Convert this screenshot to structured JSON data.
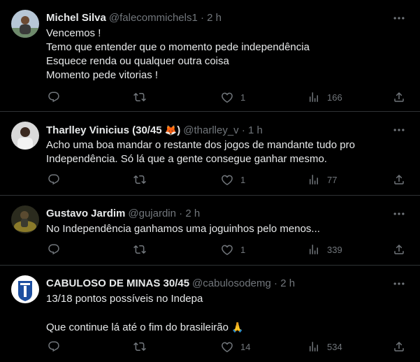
{
  "tweets": [
    {
      "name": "Michel Silva",
      "handle": "@falecommichels1",
      "dot": "·",
      "time": "2 h",
      "lines": [
        "Vencemos !",
        "Temo que entender que o momento pede independência",
        "Esquece renda ou qualquer outra coisa",
        "Momento pede vitorias !"
      ],
      "likes": "1",
      "views": "166",
      "avatar_color": "#9bb3c9"
    },
    {
      "name": "Tharlley Vinicius (30/45",
      "name_emoji": "🦊",
      "name_close": ")",
      "handle": "@tharlley_v",
      "dot": "·",
      "time": "1 h",
      "lines": [
        "Acho uma boa mandar o restante dos jogos de mandante tudo pro",
        "Independência. Só lá que a gente consegue ganhar mesmo."
      ],
      "likes": "1",
      "views": "77",
      "avatar_color": "#e8e8e8"
    },
    {
      "name": "Gustavo Jardim",
      "handle": "@gujardin",
      "dot": "·",
      "time": "2 h",
      "lines": [
        "No Independência ganhamos uma joguinhos pelo menos..."
      ],
      "likes": "1",
      "views": "339",
      "avatar_color": "#4a4a2a"
    },
    {
      "name": "CABULOSO DE MINAS 30/45",
      "handle": "@cabulosodemg",
      "dot": "·",
      "time": "2 h",
      "lines": [
        "13/18 pontos possíveis no Indepa",
        "",
        "Que continue lá até o fim do brasileirão"
      ],
      "line_emoji": "🙏",
      "likes": "14",
      "views": "534",
      "avatar_color": "#1d4fa0"
    }
  ],
  "icons": {
    "more": "more-icon",
    "reply": "reply-icon",
    "retweet": "retweet-icon",
    "like": "like-icon",
    "views": "views-icon",
    "share": "share-icon"
  },
  "colors": {
    "background": "#000000",
    "text": "#e7e9ea",
    "muted": "#71767b",
    "divider": "#2f3336"
  }
}
